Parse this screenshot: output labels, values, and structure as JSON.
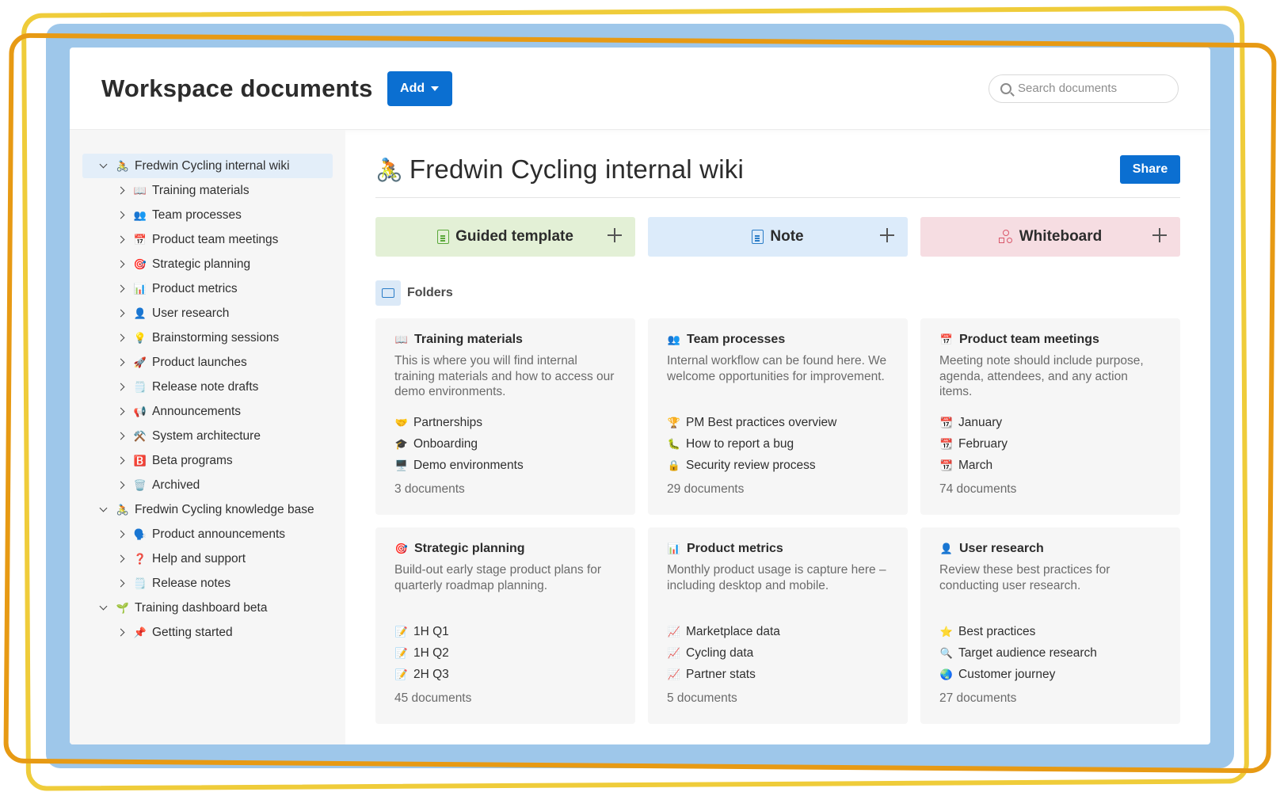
{
  "header": {
    "title": "Workspace documents",
    "add_label": "Add",
    "search_placeholder": "Search documents"
  },
  "sidebar": {
    "tree": [
      {
        "level": "root",
        "expanded": true,
        "active": true,
        "emoji": "🚴",
        "label": "Fredwin Cycling internal wiki"
      },
      {
        "level": "child",
        "emoji": "📖",
        "label": "Training materials"
      },
      {
        "level": "child",
        "emoji": "👥",
        "label": "Team processes"
      },
      {
        "level": "child",
        "emoji": "📅",
        "label": "Product team meetings"
      },
      {
        "level": "child",
        "emoji": "🎯",
        "label": "Strategic planning"
      },
      {
        "level": "child",
        "emoji": "📊",
        "label": "Product metrics"
      },
      {
        "level": "child",
        "emoji": "👤",
        "label": "User research"
      },
      {
        "level": "child",
        "emoji": "💡",
        "label": "Brainstorming sessions"
      },
      {
        "level": "child",
        "emoji": "🚀",
        "label": "Product launches"
      },
      {
        "level": "child",
        "emoji": "🗒️",
        "label": "Release note drafts"
      },
      {
        "level": "child",
        "emoji": "📢",
        "label": "Announcements"
      },
      {
        "level": "child",
        "emoji": "⚒️",
        "label": "System architecture"
      },
      {
        "level": "child",
        "emoji": "🅱️",
        "label": "Beta programs"
      },
      {
        "level": "child",
        "emoji": "🗑️",
        "label": "Archived"
      },
      {
        "level": "root",
        "expanded": true,
        "emoji": "🚴",
        "label": "Fredwin Cycling knowledge base"
      },
      {
        "level": "child",
        "emoji": "🗣️",
        "label": "Product announcements"
      },
      {
        "level": "child",
        "emoji": "❓",
        "label": "Help and support"
      },
      {
        "level": "child",
        "emoji": "🗒️",
        "label": "Release notes"
      },
      {
        "level": "root",
        "expanded": true,
        "emoji": "🌱",
        "label": "Training dashboard beta"
      },
      {
        "level": "child",
        "emoji": "📌",
        "label": "Getting started"
      }
    ]
  },
  "main": {
    "page_emoji": "🚴",
    "page_title": "Fredwin Cycling internal wiki",
    "share_label": "Share",
    "create": [
      {
        "label": "Guided template",
        "icon": "guided-template-icon",
        "color": "#e3f0d6",
        "icon_color": "#5aa83a"
      },
      {
        "label": "Note",
        "icon": "note-icon",
        "color": "#dcebfa",
        "icon_color": "#2a7cc7"
      },
      {
        "label": "Whiteboard",
        "icon": "whiteboard-icon",
        "color": "#f6dde2",
        "icon_color": "#d9576a"
      }
    ],
    "folders_label": "Folders",
    "folders": [
      {
        "emoji": "📖",
        "title": "Training materials",
        "description": "This is where you will find internal training materials and how to access our demo environments.",
        "items": [
          {
            "emoji": "🤝",
            "label": "Partnerships"
          },
          {
            "emoji": "🎓",
            "label": "Onboarding"
          },
          {
            "emoji": "🖥️",
            "label": "Demo environments"
          }
        ],
        "count": "3 documents"
      },
      {
        "emoji": "👥",
        "title": "Team processes",
        "description": "Internal workflow can be found here. We welcome opportunities for improvement.",
        "items": [
          {
            "emoji": "🏆",
            "label": "PM Best practices overview"
          },
          {
            "emoji": "🐛",
            "label": "How to report a bug"
          },
          {
            "emoji": "🔒",
            "label": "Security review process"
          }
        ],
        "count": "29 documents"
      },
      {
        "emoji": "📅",
        "title": "Product team meetings",
        "description": "Meeting note should include purpose, agenda, attendees, and any action items.",
        "items": [
          {
            "emoji": "📆",
            "label": "January"
          },
          {
            "emoji": "📆",
            "label": "February"
          },
          {
            "emoji": "📆",
            "label": "March"
          }
        ],
        "count": "74 documents"
      },
      {
        "emoji": "🎯",
        "title": "Strategic planning",
        "description": "Build-out early stage product plans for quarterly roadmap planning.",
        "items": [
          {
            "emoji": "📝",
            "label": "1H Q1"
          },
          {
            "emoji": "📝",
            "label": "1H Q2"
          },
          {
            "emoji": "📝",
            "label": "2H Q3"
          }
        ],
        "count": "45 documents"
      },
      {
        "emoji": "📊",
        "title": "Product metrics",
        "description": "Monthly product usage is capture here – including desktop and mobile.",
        "items": [
          {
            "emoji": "📈",
            "label": "Marketplace data"
          },
          {
            "emoji": "📈",
            "label": "Cycling data"
          },
          {
            "emoji": "📈",
            "label": "Partner stats"
          }
        ],
        "count": "5 documents"
      },
      {
        "emoji": "👤",
        "title": "User research",
        "description": "Review these best practices for conducting user research.",
        "items": [
          {
            "emoji": "⭐",
            "label": "Best practices"
          },
          {
            "emoji": "🔍",
            "label": "Target audience research"
          },
          {
            "emoji": "🌏",
            "label": "Customer journey"
          }
        ],
        "count": "27 documents"
      }
    ]
  }
}
